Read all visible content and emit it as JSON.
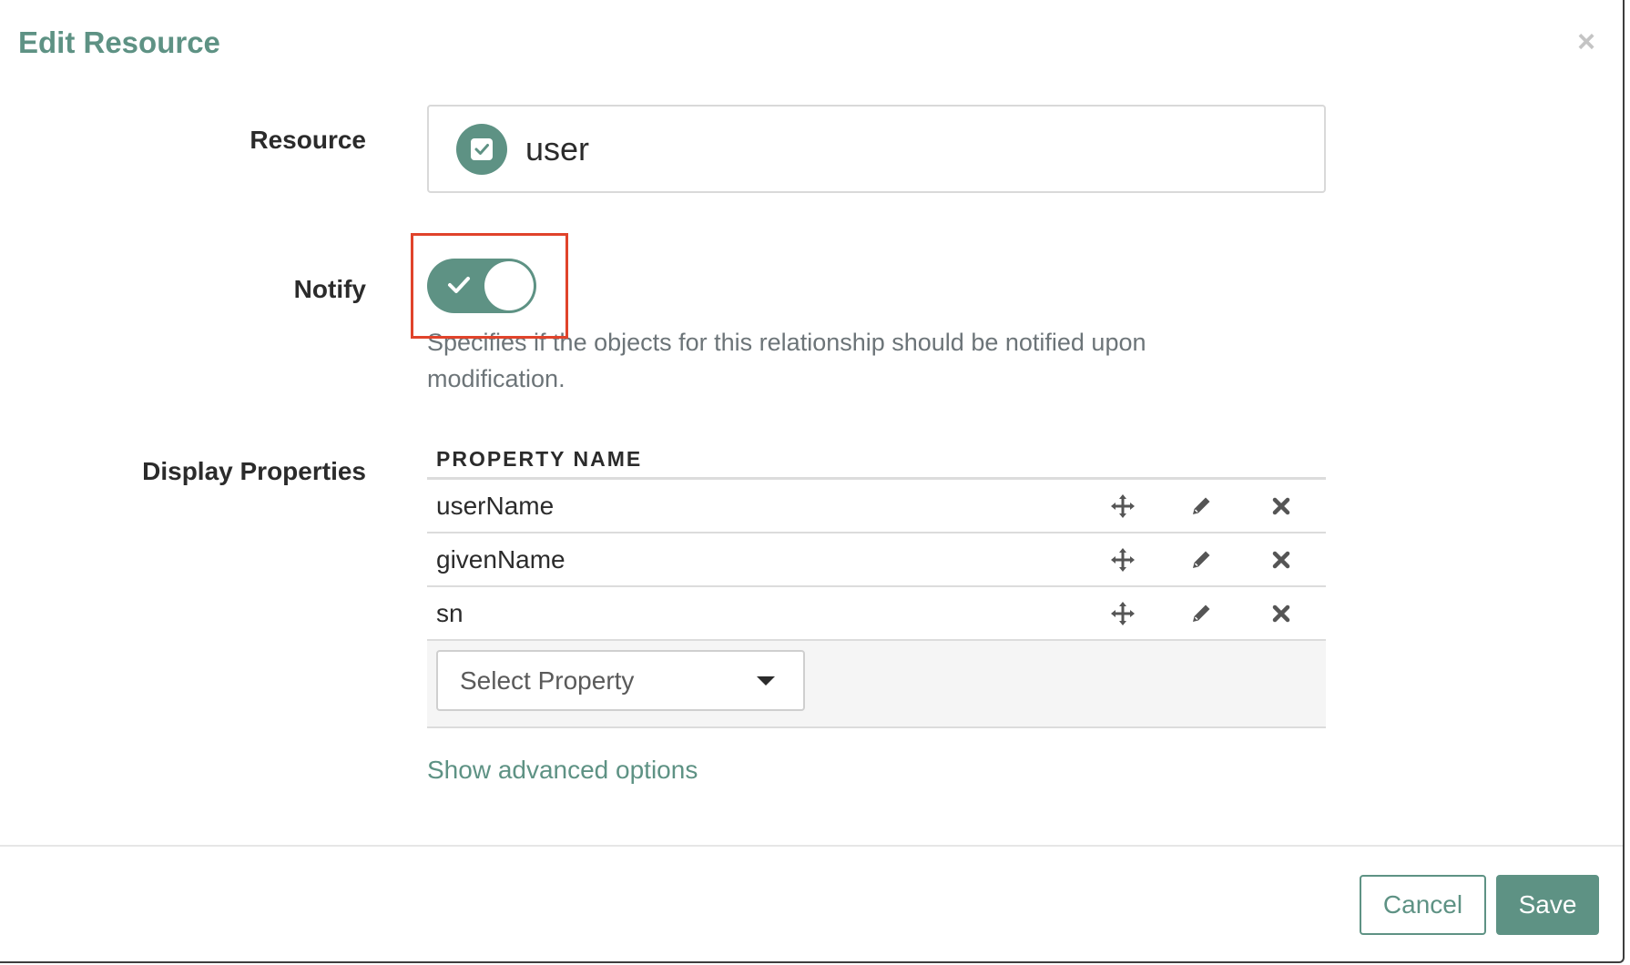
{
  "modal": {
    "title": "Edit Resource",
    "close_icon": "close-icon"
  },
  "resource": {
    "label": "Resource",
    "value": "user",
    "icon": "checkbox-icon"
  },
  "notify": {
    "label": "Notify",
    "enabled": true,
    "help_text": "Specifies if the objects for this relationship should be notified upon modification."
  },
  "display_properties": {
    "label": "Display Properties",
    "column_header": "PROPERTY NAME",
    "rows": [
      {
        "name": "userName"
      },
      {
        "name": "givenName"
      },
      {
        "name": "sn"
      }
    ],
    "select_placeholder": "Select Property"
  },
  "advanced_link": "Show advanced options",
  "footer": {
    "cancel_label": "Cancel",
    "save_label": "Save"
  },
  "colors": {
    "accent": "#5e9284",
    "highlight": "#e0432b"
  }
}
